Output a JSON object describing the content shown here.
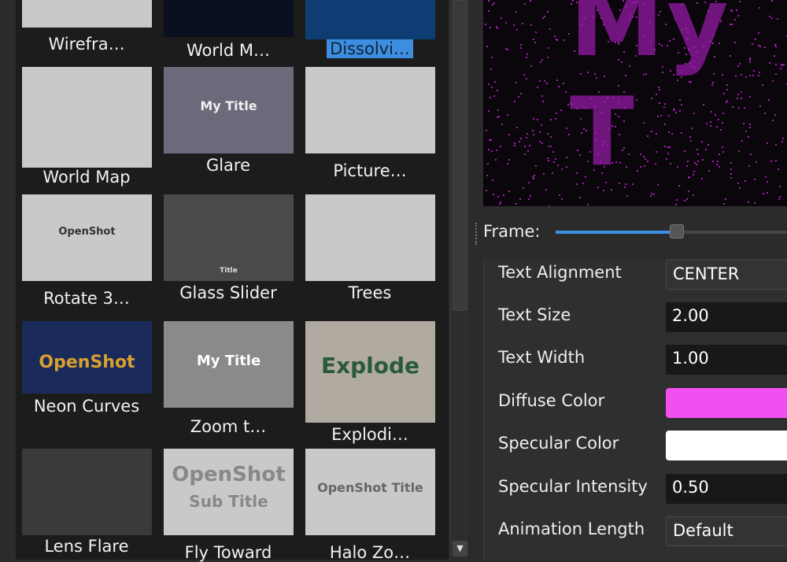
{
  "titles": [
    {
      "label": "Wirefra…",
      "bg": "#c9c9c9"
    },
    {
      "label": "World M…",
      "bg": "#0a1020"
    },
    {
      "label": "Dissolvi…",
      "bg": "#0d3d73",
      "selected": true
    },
    {
      "label": "World Map",
      "bg": "#c9c9c9"
    },
    {
      "label": "Glare",
      "bg": "#6a6a7a"
    },
    {
      "label": "Picture…",
      "bg": "#c9c9c9"
    },
    {
      "label": "Rotate 3…",
      "bg": "#c9c9c9"
    },
    {
      "label": "Glass Slider",
      "bg": "#4a4a4a"
    },
    {
      "label": "Trees",
      "bg": "#c9c9c9"
    },
    {
      "label": "Neon Curves",
      "bg": "#1a2a5a"
    },
    {
      "label": "Zoom t…",
      "bg": "#8a8a8a"
    },
    {
      "label": "Explodi…",
      "bg": "#b0aaa0"
    },
    {
      "label": "Lens Flare",
      "bg": "#3a3a3a"
    },
    {
      "label": "Fly Toward",
      "bg": "#c9c9c9"
    },
    {
      "label": "Halo Zo…",
      "bg": "#c9c9c9"
    }
  ],
  "thumb_text": {
    "glare": "My Title",
    "rotate": "OpenShot",
    "glass": "Title",
    "neon": "OpenShot",
    "zoom": "My Title",
    "explode": "Explode",
    "fly_main": "OpenShot",
    "fly_sub": "Sub Title",
    "halo": "OpenShot Title"
  },
  "preview": {
    "text": "My T"
  },
  "frame": {
    "label": "Frame:",
    "position": 0.5
  },
  "properties": [
    {
      "label": "Text Alignment",
      "value": "CENTER",
      "type": "combo"
    },
    {
      "label": "Text Size",
      "value": "2.00",
      "type": "number"
    },
    {
      "label": "Text Width",
      "value": "1.00",
      "type": "number"
    },
    {
      "label": "Diffuse Color",
      "value": "",
      "type": "color",
      "color": "#f050f0"
    },
    {
      "label": "Specular Color",
      "value": "",
      "type": "color",
      "color": "#ffffff"
    },
    {
      "label": "Specular Intensity",
      "value": "0.50",
      "type": "number"
    },
    {
      "label": "Animation Length",
      "value": "Default",
      "type": "combo"
    }
  ]
}
